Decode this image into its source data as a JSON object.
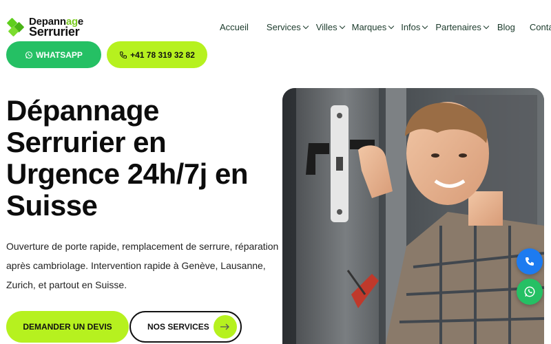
{
  "logo": {
    "line1_a": "Depann",
    "line1_b": "ag",
    "line1_c": "e",
    "line2": "Serrurier"
  },
  "nav": [
    {
      "label": "Accueil",
      "dropdown": false
    },
    {
      "label": "Services",
      "dropdown": true
    },
    {
      "label": "Villes",
      "dropdown": true
    },
    {
      "label": "Marques",
      "dropdown": true
    },
    {
      "label": "Infos",
      "dropdown": true
    },
    {
      "label": "Partenaires",
      "dropdown": true
    },
    {
      "label": "Blog",
      "dropdown": false
    },
    {
      "label": "Contact",
      "dropdown": false
    }
  ],
  "buttons": {
    "whatsapp": "WHATSAPP",
    "phone": "+41 78 319 32 82",
    "devis": "DEMANDER UN DEVIS",
    "services": "NOS SERVICES"
  },
  "hero": {
    "title_lines": [
      "Dépannage",
      "Serrurier en",
      "Urgence 24h/7j en",
      "Suisse"
    ],
    "description": "Ouverture de porte rapide, remplacement de serrure, réparation après cambriolage. Intervention rapide à Genève, Lausanne, Zurich, et partout en Suisse."
  },
  "colors": {
    "accent_lime": "#b6f11f",
    "whatsapp_green": "#25c064",
    "call_blue": "#1d7bf0"
  },
  "icons": [
    "whatsapp-icon",
    "phone-icon",
    "arrow-right-icon"
  ]
}
